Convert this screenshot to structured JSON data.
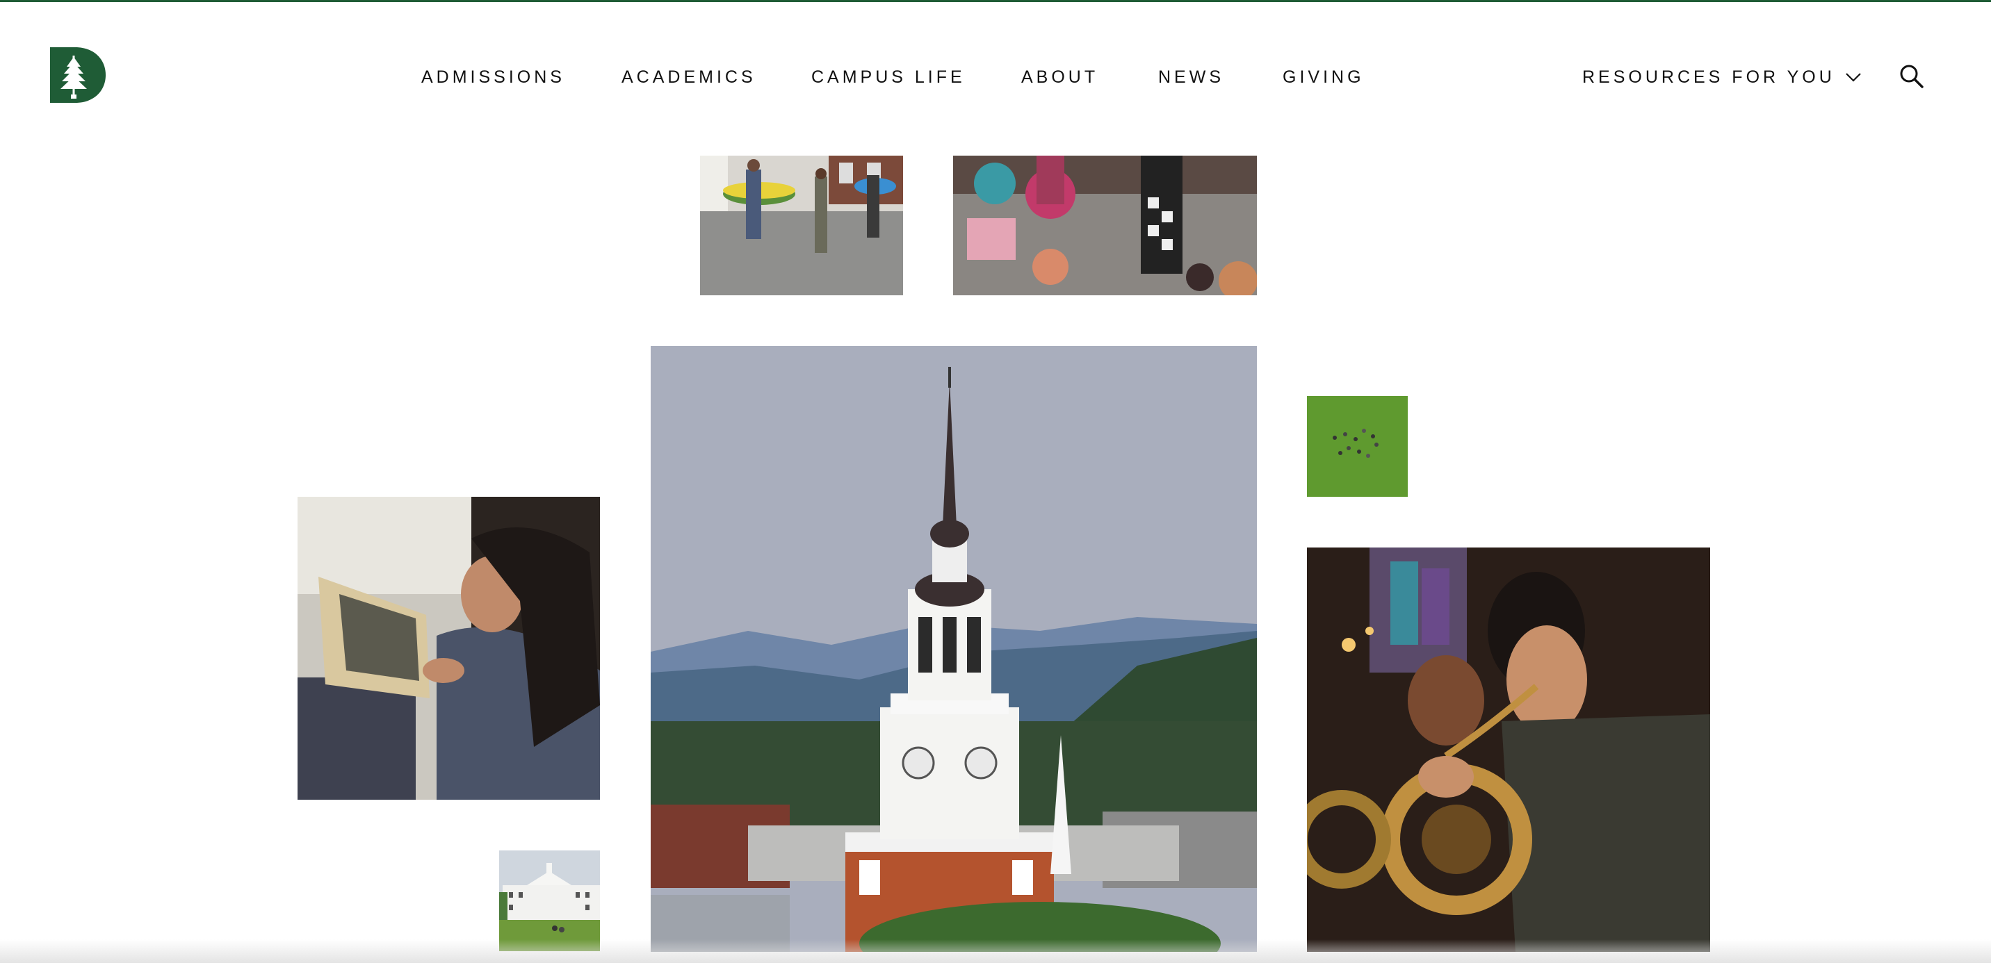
{
  "brand": {
    "logo_icon": "dartmouth-pine-d-logo",
    "color": "#1f5c36"
  },
  "nav": {
    "items": [
      {
        "label": "ADMISSIONS"
      },
      {
        "label": "ACADEMICS"
      },
      {
        "label": "CAMPUS LIFE"
      },
      {
        "label": "ABOUT"
      },
      {
        "label": "NEWS"
      },
      {
        "label": "GIVING"
      }
    ],
    "resources_label": "RESOURCES FOR YOU",
    "resources_icon": "chevron-down-icon",
    "search_icon": "search-icon"
  },
  "gallery": {
    "photos": [
      {
        "name": "photo-students-with-inner-tubes"
      },
      {
        "name": "photo-chalk-art-festival"
      },
      {
        "name": "photo-student-archives-research"
      },
      {
        "name": "photo-baker-tower-clocktower"
      },
      {
        "name": "photo-aerial-green-lawn"
      },
      {
        "name": "photo-horn-player-orchestra"
      },
      {
        "name": "photo-dartmouth-hall"
      }
    ]
  }
}
